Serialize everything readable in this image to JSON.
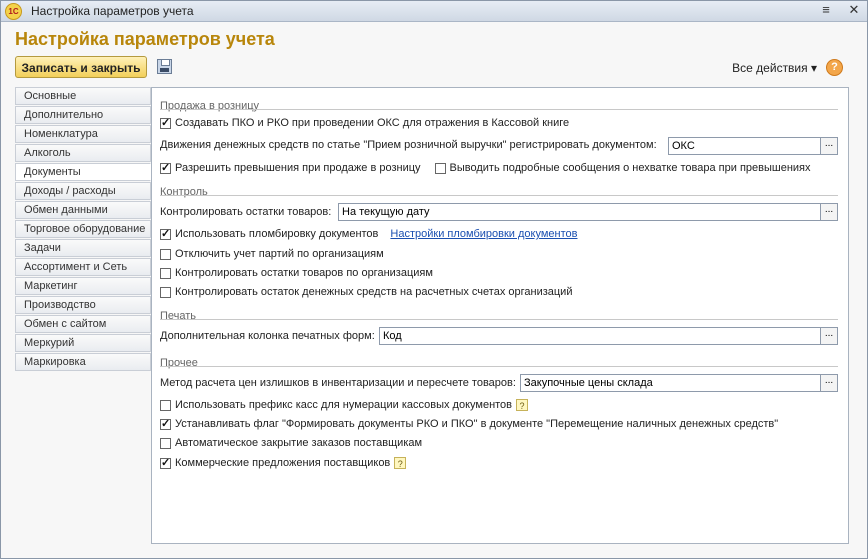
{
  "window": {
    "title": "Настройка параметров учета",
    "app_icon": "1С"
  },
  "page": {
    "title": "Настройка параметров учета"
  },
  "toolbar": {
    "save_close_label": "Записать и закрыть",
    "all_actions_label": "Все действия ▾",
    "help_label": "?"
  },
  "nav": {
    "items": [
      "Основные",
      "Дополнительно",
      "Номенклатура",
      "Алкоголь",
      "Документы",
      "Доходы / расходы",
      "Обмен данными",
      "Торговое оборудование",
      "Задачи",
      "Ассортимент и Сеть",
      "Маркетинг",
      "Производство",
      "Обмен с сайтом",
      "Меркурий",
      "Маркировка"
    ],
    "active": "Документы"
  },
  "sections": {
    "retail": {
      "title": "Продажа в розницу",
      "create_pko": "Создавать ПКО и РКО при проведении ОКС для отражения в Кассовой книге",
      "create_pko_checked": true,
      "movement_label": "Движения денежных средств по статье \"Прием розничной выручки\" регистрировать документом:",
      "movement_value": "ОКС",
      "allow_excess": "Разрешить превышения при продаже в розницу",
      "allow_excess_checked": true,
      "detailed_messages": "Выводить подробные сообщения о нехватке товара при превышениях",
      "detailed_messages_checked": false
    },
    "control": {
      "title": "Контроль",
      "stock_label": "Контролировать остатки товаров:",
      "stock_value": "На текущую дату",
      "sealing": "Использовать пломбировку документов",
      "sealing_checked": true,
      "sealing_link": "Настройки пломбировки документов",
      "disable_batches": "Отключить учет партий по организациям",
      "disable_batches_checked": false,
      "control_stock_org": "Контролировать остатки товаров по организациям",
      "control_stock_org_checked": false,
      "control_cash": "Контролировать остаток денежных средств на расчетных счетах организаций",
      "control_cash_checked": false
    },
    "print": {
      "title": "Печать",
      "extra_column_label": "Дополнительная колонка печатных форм:",
      "extra_column_value": "Код"
    },
    "other": {
      "title": "Прочее",
      "price_method_label": "Метод расчета цен излишков в инвентаризации и пересчете товаров:",
      "price_method_value": "Закупочные цены склада",
      "cash_prefix": "Использовать префикс касс для нумерации кассовых документов",
      "cash_prefix_checked": false,
      "set_flag": "Устанавливать флаг \"Формировать документы РКО и ПКО\" в документе \"Перемещение наличных денежных средств\"",
      "set_flag_checked": true,
      "auto_close": "Автоматическое закрытие заказов поставщикам",
      "auto_close_checked": false,
      "commercial": "Коммерческие предложения поставщиков",
      "commercial_checked": true
    }
  }
}
